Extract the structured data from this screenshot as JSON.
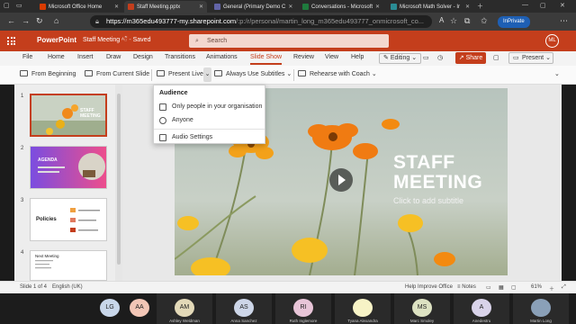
{
  "browser": {
    "tabs": [
      {
        "title": "Microsoft Office Home",
        "favicon_color": "#d83b01",
        "active": false
      },
      {
        "title": "Staff Meeting.pptx",
        "favicon_color": "#c43e1c",
        "active": true
      },
      {
        "title": "General (Primary Demo C",
        "favicon_color": "#6264a7",
        "active": false
      },
      {
        "title": "Conversations - Microsoft",
        "favicon_color": "#1f7a3d",
        "active": false
      },
      {
        "title": "Microsoft Math Solver - Ir",
        "favicon_color": "#2a8c94",
        "active": false
      }
    ],
    "url_host": "https://m365edu493777-my.sharepoint.com",
    "url_path": "/:p:/r/personal/martin_long_m365edu493777_onmicrosoft_co...",
    "inprivate_label": "InPrivate"
  },
  "app": {
    "name": "PowerPoint",
    "doc_title": "Staff Meeting",
    "doc_status": "Saved",
    "search_placeholder": "Search",
    "user_initials": "ML"
  },
  "menu": {
    "items": [
      "File",
      "Home",
      "Insert",
      "Draw",
      "Design",
      "Transitions",
      "Animations",
      "Slide Show",
      "Review",
      "View",
      "Help"
    ],
    "active": "Slide Show",
    "editing_label": "Editing",
    "share_label": "Share",
    "present_label": "Present"
  },
  "ribbon": {
    "from_beginning": "From Beginning",
    "from_current": "From Current Slide",
    "present_live": "Present Live",
    "subtitles": "Always Use Subtitles",
    "rehearse": "Rehearse with Coach"
  },
  "dropdown": {
    "heading": "Audience",
    "items": [
      "Only people in your organisation",
      "Anyone"
    ],
    "audio": "Audio Settings"
  },
  "slides": {
    "numbers": [
      "1",
      "2",
      "3",
      "4"
    ],
    "s1_title": "STAFF MEETING",
    "s2_title": "AGENDA",
    "s3_title": "Policies",
    "s4_title": "Next Meeting"
  },
  "slide": {
    "title_line1": "STAFF",
    "title_line2": "MEETING",
    "subtitle": "Click to add subtitle"
  },
  "status": {
    "slide_count": "Slide 1 of 4",
    "language": "English (UK)",
    "help_improve": "Help Improve Office",
    "notes": "Notes",
    "zoom": "61%"
  },
  "participants": [
    {
      "initials": "LG",
      "name": "",
      "color": "#c9d7ea"
    },
    {
      "initials": "AA",
      "name": "",
      "color": "#f2c6b6"
    },
    {
      "initials": "AM",
      "name": "Ashley Weldman",
      "color": "#e3d9b8"
    },
    {
      "initials": "AS",
      "name": "Anna Sanchez",
      "color": "#cdd6e8"
    },
    {
      "initials": "RI",
      "name": "Ruth Inglemore",
      "color": "#e8c5d8"
    },
    {
      "initials": "",
      "name": "Tyana Alexandra",
      "color": "#f7f3c6"
    },
    {
      "initials": "MS",
      "name": "Marc Smoley",
      "color": "#dde2c2"
    },
    {
      "initials": "A",
      "name": "Anedestru",
      "color": "#d9d3ea"
    },
    {
      "initials": "",
      "name": "Martin Long",
      "color": "#8aa0b8"
    }
  ]
}
